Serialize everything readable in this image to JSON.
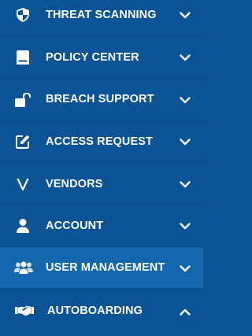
{
  "colors": {
    "background": "#0b5394",
    "active_background": "#1467ad",
    "divider": "#0a4a85",
    "text": "#ffffff"
  },
  "menu": {
    "items": [
      {
        "label": "THREAT SCANNING",
        "icon": "shield-icon",
        "expanded": false
      },
      {
        "label": "POLICY CENTER",
        "icon": "book-icon",
        "expanded": false
      },
      {
        "label": "BREACH SUPPORT",
        "icon": "unlock-icon",
        "expanded": false
      },
      {
        "label": "ACCESS REQUEST",
        "icon": "edit-icon",
        "expanded": false
      },
      {
        "label": "VENDORS",
        "icon": "v-letter-icon",
        "expanded": false
      },
      {
        "label": "ACCOUNT",
        "icon": "user-icon",
        "expanded": false
      },
      {
        "label": "USER MANAGEMENT",
        "icon": "users-icon",
        "expanded": false
      },
      {
        "label": "AUTOBOARDING",
        "icon": "handshake-icon",
        "expanded": true
      }
    ]
  }
}
